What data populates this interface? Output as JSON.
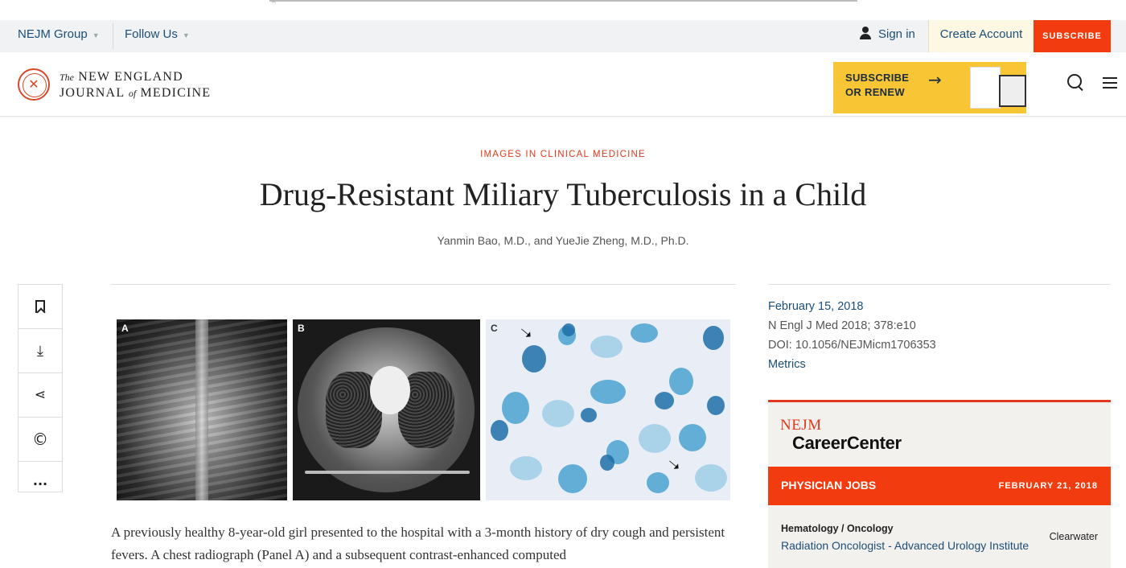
{
  "utility": {
    "nejm_group": "NEJM Group",
    "follow_us": "Follow Us",
    "sign_in": "Sign in",
    "create_account": "Create Account",
    "subscribe": "SUBSCRIBE"
  },
  "masthead": {
    "logo_the": "The",
    "logo_line1": "NEW ENGLAND",
    "logo_line2a": "JOURNAL",
    "logo_of": "of",
    "logo_line2b": "MEDICINE",
    "promo_line1": "SUBSCRIBE",
    "promo_line2": "OR RENEW"
  },
  "article": {
    "section": "IMAGES IN CLINICAL MEDICINE",
    "title": "Drug-Resistant Miliary Tuberculosis in a Child",
    "authors": "Yanmin Bao, M.D., and YueJie Zheng, M.D., Ph.D.",
    "panels": [
      "A",
      "B",
      "C"
    ],
    "body": "A previously healthy 8-year-old girl presented to the hospital with a 3-month history of dry cough and persistent fevers. A chest radiograph (Panel A) and a subsequent contrast-enhanced computed"
  },
  "meta": {
    "date": "February 15, 2018",
    "citation": "N Engl J Med 2018; 378:e10",
    "doi": "DOI: 10.1056/NEJMicm1706353",
    "metrics": "Metrics"
  },
  "career": {
    "logo_nejm": "NEJM",
    "logo_center": "CareerCenter",
    "jobs_title": "PHYSICIAN JOBS",
    "jobs_date": "FEBRUARY 21, 2018",
    "job_category": "Hematology / Oncology",
    "job_title": "Radiation Oncologist - Advanced Urology Institute",
    "job_location": "Clearwater"
  },
  "icons": [
    "user-icon",
    "search-icon",
    "menu-icon",
    "bookmark-icon",
    "download-icon",
    "share-icon",
    "copyright-icon",
    "more-icon",
    "arrow-right-icon"
  ],
  "colors": {
    "accent": "#f23b0e",
    "link": "#1b4e78",
    "promo": "#f8c534",
    "section": "#e0391c"
  }
}
